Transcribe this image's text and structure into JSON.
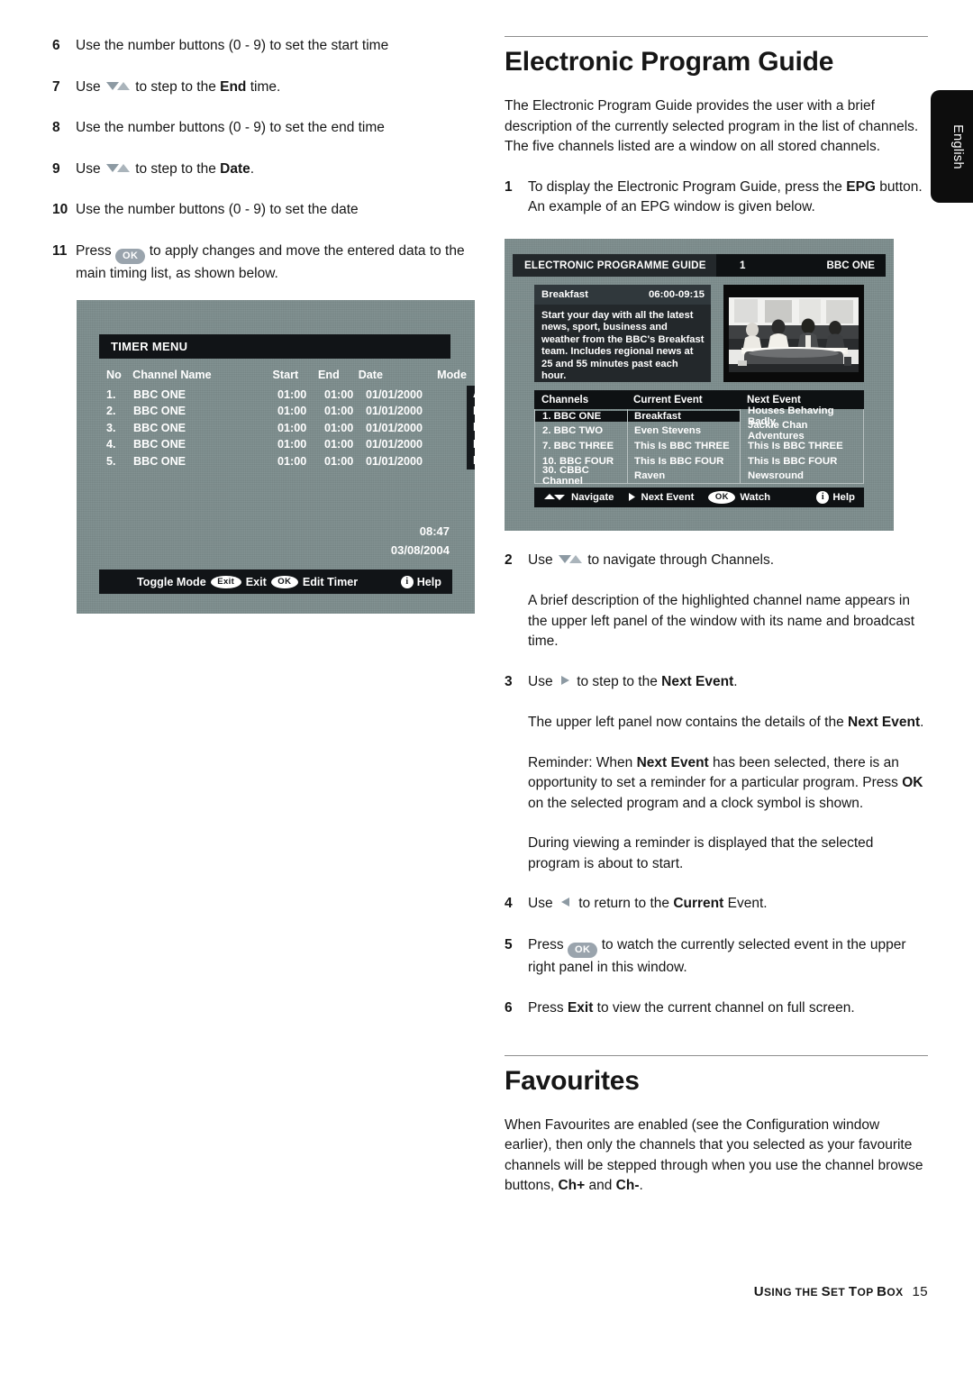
{
  "language_tab": {
    "label": "English"
  },
  "left_column": {
    "steps": [
      {
        "num": "6",
        "text_html": "Use the number buttons (0 - 9) to set the start time"
      },
      {
        "num": "7",
        "prefix": "Use",
        "icon": "down-up-arrows-icon",
        "suffix_html": "to step to the <b>End</b> time."
      },
      {
        "num": "8",
        "text_html": "Use the number buttons (0 - 9) to set the end time"
      },
      {
        "num": "9",
        "prefix": "Use",
        "icon": "down-up-arrows-icon",
        "suffix_html": "to step to the <b>Date</b>."
      },
      {
        "num": "10",
        "text_html": "Use the number buttons (0 - 9) to set the date"
      },
      {
        "num": "11",
        "prefix": "Press",
        "icon": "ok-pill-icon",
        "suffix_html": "to apply changes and move the entered data to the main timing list, as shown below."
      }
    ]
  },
  "timer_menu": {
    "title": "TIMER MENU",
    "columns": [
      "No",
      "Channel Name",
      "Start",
      "End",
      "Date",
      "Mode"
    ],
    "rows": [
      {
        "no": "1.",
        "name": "BBC ONE",
        "start": "01:00",
        "end": "01:00",
        "date": "01/01/2000",
        "mode": "Active"
      },
      {
        "no": "2.",
        "name": "BBC ONE",
        "start": "01:00",
        "end": "01:00",
        "date": "01/01/2000",
        "mode": "Inactive"
      },
      {
        "no": "3.",
        "name": "BBC ONE",
        "start": "01:00",
        "end": "01:00",
        "date": "01/01/2000",
        "mode": "Inactive"
      },
      {
        "no": "4.",
        "name": "BBC ONE",
        "start": "01:00",
        "end": "01:00",
        "date": "01/01/2000",
        "mode": "Inactive"
      },
      {
        "no": "5.",
        "name": "BBC ONE",
        "start": "01:00",
        "end": "01:00",
        "date": "01/01/2000",
        "mode": "Inactive"
      }
    ],
    "clock_time": "08:47",
    "clock_date": "03/08/2004",
    "bar": {
      "toggle_label": "Toggle Mode",
      "exit_key": "Exit",
      "exit_label": "Exit",
      "ok_key": "OK",
      "ok_label": "Edit Timer",
      "help_label": "Help",
      "help_key": "i"
    }
  },
  "right_column": {
    "heading": "Electronic Program Guide",
    "intro": "The Electronic Program Guide provides the user with a brief description of the currently selected program in the list of channels. The five channels listed are a window on all stored channels.",
    "step1_num": "1",
    "step1_html": "To display the Electronic Program Guide, press the <b>EPG</b> button. An example of an EPG window is given below.",
    "step2_num": "2",
    "step2_prefix": "Use",
    "step2_suffix": "to navigate through Channels.",
    "para_after_2": "A brief description of the highlighted channel name appears in the upper left panel of the window with its name and broadcast time.",
    "step3_num": "3",
    "step3_prefix": "Use",
    "step3_suffix_html": "to step to the <b>Next Event</b>.",
    "para_after_3_html": "The upper left panel now contains the details of the <b>Next Event</b>.",
    "para_reminder_html": "Reminder: When <b>Next Event</b> has been selected, there is an opportunity to set a reminder for a particular program. Press <b>OK</b> on the selected program and a clock symbol is shown.",
    "para_viewing": "During viewing a reminder is displayed that the selected program is about to start.",
    "step4_num": "4",
    "step4_prefix": "Use",
    "step4_suffix_html": "to return to the <b>Current</b> Event.",
    "step5_num": "5",
    "step5_prefix": "Press",
    "step5_suffix": "to watch the currently selected event in the upper right panel in this window.",
    "step6_num": "6",
    "step6_html": "Press <b>Exit</b> to view the current channel on full screen."
  },
  "favourites": {
    "heading": "Favourites",
    "body_html": "When Favourites are enabled (see the Configuration window earlier), then only the channels that you selected as your favourite channels will be stepped through when you use the channel browse buttons, <b>Ch+</b> and <b>Ch-</b>."
  },
  "epg": {
    "header_label": "ELECTRONIC PROGRAMME GUIDE",
    "header_channel_number": "1",
    "header_channel_name": "BBC ONE",
    "desc_title": "Breakfast",
    "desc_time": "06:00-09:15",
    "desc_body": "Start your day with all the latest news, sport, business and weather from the BBC's Breakfast team. Includes regional news at 25 and 55 minutes past each hour.",
    "grid_headers": [
      "Channels",
      "Current Event",
      "Next Event"
    ],
    "grid_rows": [
      {
        "channel": "1. BBC ONE",
        "current": "Breakfast",
        "next": "Houses Behaving Badly"
      },
      {
        "channel": "2. BBC TWO",
        "current": "Even Stevens",
        "next": "Jackie Chan Adventures"
      },
      {
        "channel": "7. BBC THREE",
        "current": "This Is BBC THREE",
        "next": "This Is BBC THREE"
      },
      {
        "channel": "10. BBC FOUR",
        "current": "This Is BBC FOUR",
        "next": "This Is BBC FOUR"
      },
      {
        "channel": "30. CBBC Channel",
        "current": "Raven",
        "next": "Newsround"
      }
    ],
    "bar": {
      "navigate_label": "Navigate",
      "next_event_label": "Next Event",
      "ok_key": "OK",
      "watch_label": "Watch",
      "help_key": "i",
      "help_label": "Help"
    }
  },
  "footer": {
    "title_first": "U",
    "title_rest": "SING THE ",
    "title_s": "S",
    "title_et": "ET ",
    "title_t": "T",
    "title_op": "OP ",
    "title_b": "B",
    "title_ox": "OX",
    "full_title": "USING THE SET TOP BOX",
    "page_number": "15"
  },
  "colors": {
    "screen_bg": "#7d8d8d",
    "screen_dark": "#111417",
    "accent_arrow": "#8d9aa3"
  }
}
